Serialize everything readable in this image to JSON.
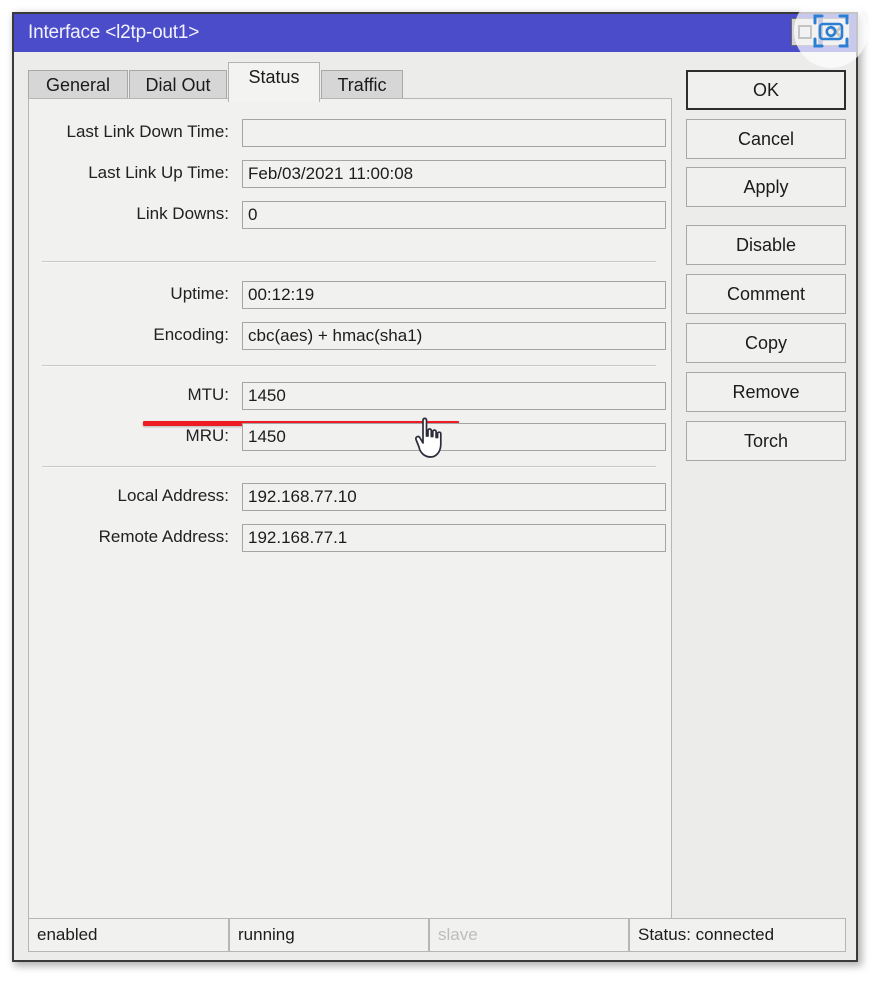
{
  "window": {
    "title": "Interface <l2tp-out1>",
    "buttons": {
      "maximize": "maximize-button",
      "close": "close-button"
    }
  },
  "tabs": [
    {
      "label": "General",
      "active": false
    },
    {
      "label": "Dial Out",
      "active": false
    },
    {
      "label": "Status",
      "active": true
    },
    {
      "label": "Traffic",
      "active": false
    }
  ],
  "form": {
    "groups": [
      {
        "fields": [
          {
            "label": "Last Link Down Time:",
            "value": ""
          },
          {
            "label": "Last Link Up Time:",
            "value": "Feb/03/2021 11:00:08"
          },
          {
            "label": "Link Downs:",
            "value": "0"
          }
        ]
      },
      {
        "fields": [
          {
            "label": "Uptime:",
            "value": "00:12:19"
          },
          {
            "label": "Encoding:",
            "value": "cbc(aes) + hmac(sha1)"
          }
        ]
      },
      {
        "fields": [
          {
            "label": "MTU:",
            "value": "1450"
          },
          {
            "label": "MRU:",
            "value": "1450"
          }
        ]
      },
      {
        "fields": [
          {
            "label": "Local Address:",
            "value": "192.168.77.10"
          },
          {
            "label": "Remote Address:",
            "value": "192.168.77.1"
          }
        ]
      }
    ]
  },
  "annotation": {
    "type": "red-underline",
    "target_field": "Encoding:",
    "color": "#ed1b23"
  },
  "action_buttons": [
    {
      "label": "OK",
      "default": true
    },
    {
      "label": "Cancel",
      "default": false
    },
    {
      "label": "Apply",
      "default": false
    },
    {
      "label": "Disable",
      "default": false
    },
    {
      "label": "Comment",
      "default": false
    },
    {
      "label": "Copy",
      "default": false
    },
    {
      "label": "Remove",
      "default": false
    },
    {
      "label": "Torch",
      "default": false
    }
  ],
  "statusbar": [
    {
      "text": "enabled",
      "dim": false
    },
    {
      "text": "running",
      "dim": false
    },
    {
      "text": "slave",
      "dim": true
    },
    {
      "text": "Status: connected",
      "dim": false
    }
  ],
  "overlay": {
    "badge_icon": "camera-screenshot-icon",
    "badge_color": "#2a7fd4",
    "cursor_icon": "pointing-hand-cursor"
  },
  "theme": {
    "titlebar": "#4b4cc9",
    "window_bg": "#ececeb",
    "panel_bg": "#f1f1f0",
    "border": "#b6b6b6"
  }
}
